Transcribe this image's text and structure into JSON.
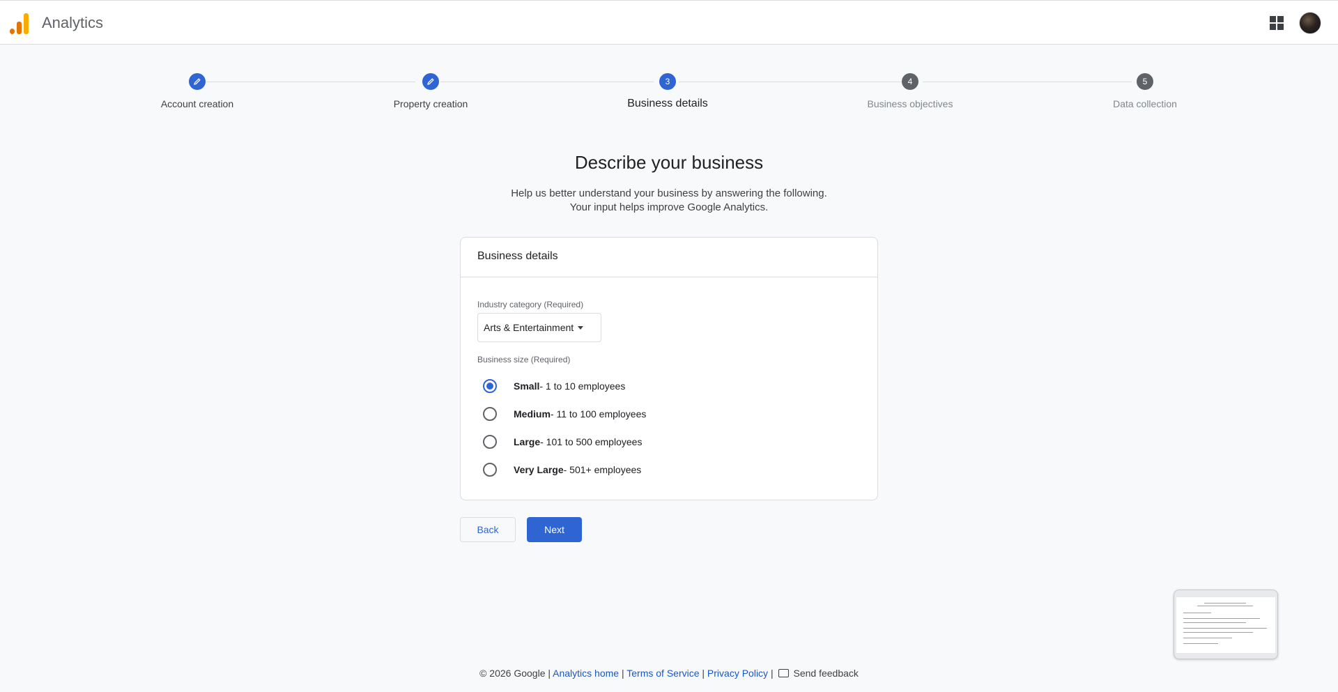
{
  "header": {
    "app_title": "Analytics",
    "apps_icon": "apps-grid-icon",
    "avatar_icon": "user-avatar"
  },
  "stepper": {
    "steps": [
      {
        "label": "Account creation",
        "state": "done",
        "icon": "pencil-icon"
      },
      {
        "label": "Property creation",
        "state": "done",
        "icon": "pencil-icon"
      },
      {
        "label": "Business details",
        "state": "active",
        "number": "3"
      },
      {
        "label": "Business objectives",
        "state": "future",
        "number": "4"
      },
      {
        "label": "Data collection",
        "state": "future",
        "number": "5"
      }
    ]
  },
  "main": {
    "title": "Describe your business",
    "subtitle_line1": "Help us better understand your business by answering the following.",
    "subtitle_line2": "Your input helps improve Google Analytics."
  },
  "card": {
    "title": "Business details",
    "industry_label": "Industry category (Required)",
    "industry_value": "Arts & Entertainment",
    "size_label": "Business size (Required)",
    "sizes": [
      {
        "name": "Small",
        "desc": " - 1 to 10 employees",
        "checked": true
      },
      {
        "name": "Medium",
        "desc": " - 11 to 100 employees",
        "checked": false
      },
      {
        "name": "Large",
        "desc": " - 101 to 500 employees",
        "checked": false
      },
      {
        "name": "Very Large",
        "desc": " - 501+ employees",
        "checked": false
      }
    ]
  },
  "buttons": {
    "back": "Back",
    "next": "Next"
  },
  "footer": {
    "copyright": "© 2026 Google |",
    "links": [
      "Analytics home",
      "Terms of Service",
      "Privacy Policy"
    ],
    "separator": "|",
    "feedback": "Send feedback"
  },
  "colors": {
    "accent": "#2f64d3",
    "background": "#f8f9fa"
  }
}
